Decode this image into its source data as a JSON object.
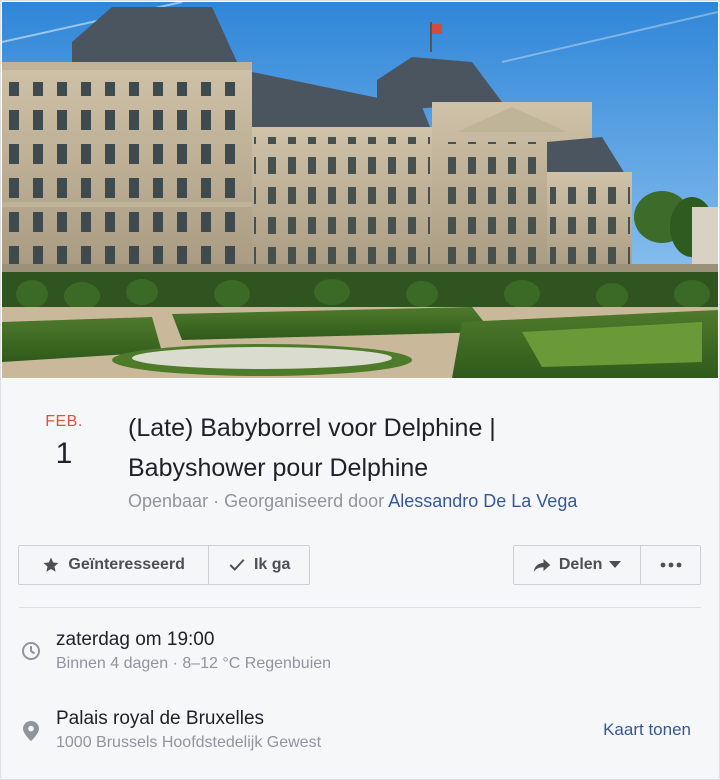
{
  "event": {
    "date_month": "FEB.",
    "date_day": "1",
    "title_line1": "(Late) Babyborrel voor Delphine |",
    "title_line2": "Babyshower pour Delphine",
    "visibility": "Openbaar",
    "organizer_prefix": "Georganiseerd door",
    "organizer": "Alessandro De La Vega"
  },
  "actions": {
    "interested_label": "Geïnteresseerd",
    "interested_icon": "star-icon",
    "going_label": "Ik ga",
    "going_icon": "checkmark-icon",
    "share_label": "Delen",
    "share_icon": "share-arrow-icon",
    "more_icon": "more-dots-icon"
  },
  "details": {
    "time_main": "zaterdag om 19:00",
    "time_sub": "Binnen 4 dagen · 8–12 °C Regenbuien",
    "time_icon": "clock-icon",
    "location_name": "Palais royal de Bruxelles",
    "location_address": "1000 Brussels Hoofdstedelijk Gewest",
    "location_icon": "location-pin-icon",
    "map_link": "Kaart tonen"
  },
  "colors": {
    "month_red": "#e74c3c",
    "link_blue": "#365899",
    "muted_gray": "#90949c",
    "button_bg": "#f5f6f7"
  }
}
